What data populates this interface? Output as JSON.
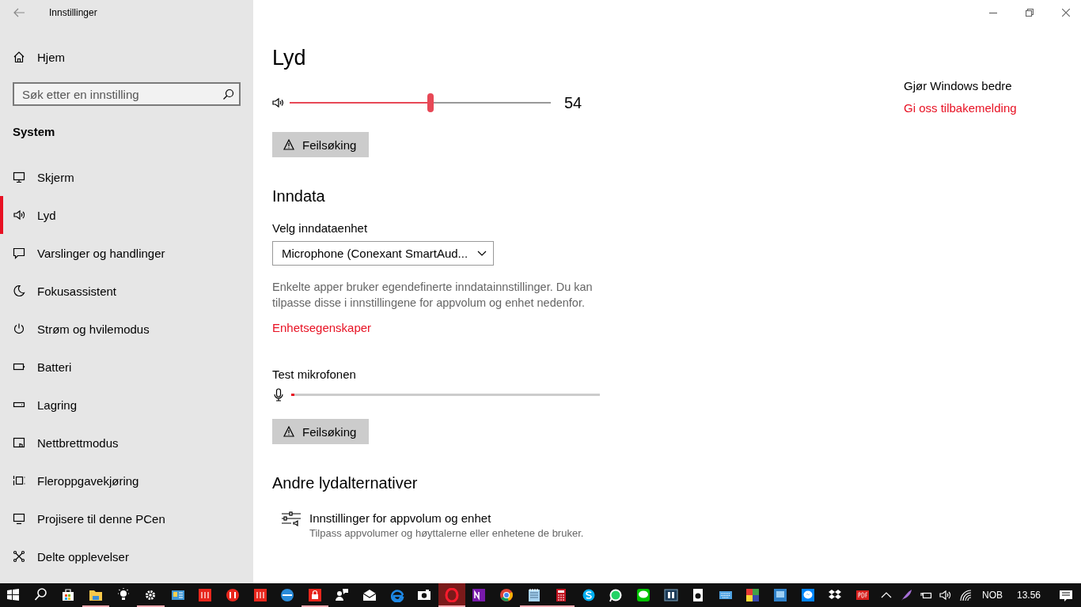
{
  "window": {
    "title": "Innstillinger"
  },
  "sidebar": {
    "home": "Hjem",
    "search": {
      "placeholder": "Søk etter en innstilling"
    },
    "section": "System",
    "items": [
      {
        "label": "Skjerm",
        "kind": "display",
        "selected": false
      },
      {
        "label": "Lyd",
        "kind": "sound",
        "selected": true
      },
      {
        "label": "Varslinger og handlinger",
        "kind": "message",
        "selected": false
      },
      {
        "label": "Fokusassistent",
        "kind": "moon",
        "selected": false
      },
      {
        "label": "Strøm og hvilemodus",
        "kind": "power",
        "selected": false
      },
      {
        "label": "Batteri",
        "kind": "battery",
        "selected": false
      },
      {
        "label": "Lagring",
        "kind": "storage",
        "selected": false
      },
      {
        "label": "Nettbrettmodus",
        "kind": "tablet",
        "selected": false
      },
      {
        "label": "Fleroppgavekjøring",
        "kind": "multitask",
        "selected": false
      },
      {
        "label": "Projisere til denne PCen",
        "kind": "project",
        "selected": false
      },
      {
        "label": "Delte opplevelser",
        "kind": "share",
        "selected": false
      }
    ]
  },
  "main": {
    "title": "Lyd",
    "volume": {
      "level": 0.54,
      "reading": "54"
    },
    "troubleshoot_output": "Feilsøking",
    "input_heading": "Inndata",
    "device_label": "Velg inndataenhet",
    "device_value": "Microphone (Conexant SmartAud...",
    "description": "Enkelte apper bruker egendefinerte inndatainnstillinger. Du kan tilpasse disse i innstillingene for appvolum og enhet nedenfor.",
    "device_link": "Enhetsegenskaper",
    "test_label": "Test mikrofonen",
    "mic": {
      "level": 0.01
    },
    "troubleshoot_input": "Feilsøking",
    "other_heading": "Andre lydalternativer",
    "option": {
      "title": "Innstillinger for appvolum og enhet",
      "subtitle": "Tilpass appvolumer og høyttalerne eller enhetene de bruker."
    }
  },
  "aside": {
    "heading": "Gjør Windows bedre",
    "link": "Gi oss tilbakemelding"
  },
  "taskbar": {
    "apps": [
      {
        "kind": "start",
        "running": false,
        "active": false
      },
      {
        "kind": "search",
        "running": false,
        "active": false
      },
      {
        "kind": "store",
        "running": false,
        "active": false
      },
      {
        "kind": "folder",
        "running": true,
        "active": false
      },
      {
        "kind": "bulb",
        "running": false,
        "active": false
      },
      {
        "kind": "gear",
        "running": true,
        "active": false
      },
      {
        "kind": "card",
        "running": false,
        "active": false
      },
      {
        "kind": "red",
        "running": false,
        "active": false
      },
      {
        "kind": "redcircle",
        "running": false,
        "active": false
      },
      {
        "kind": "red",
        "running": false,
        "active": false
      },
      {
        "kind": "bluecircle",
        "running": false,
        "active": false
      },
      {
        "kind": "lock",
        "running": true,
        "active": false
      },
      {
        "kind": "people",
        "running": false,
        "active": false
      },
      {
        "kind": "mail",
        "running": false,
        "active": false
      },
      {
        "kind": "edge",
        "running": false,
        "active": false
      },
      {
        "kind": "camera",
        "running": false,
        "active": false
      },
      {
        "kind": "opera",
        "running": true,
        "active": true
      },
      {
        "kind": "onenote",
        "running": false,
        "active": false
      },
      {
        "kind": "chrome",
        "running": false,
        "active": false
      },
      {
        "kind": "notepad",
        "running": true,
        "active": false
      },
      {
        "kind": "calculator",
        "running": true,
        "active": false
      },
      {
        "kind": "skype",
        "running": false,
        "active": false
      },
      {
        "kind": "whatsapp",
        "running": false,
        "active": false
      },
      {
        "kind": "chat",
        "running": false,
        "active": false
      },
      {
        "kind": "dolby",
        "running": false,
        "active": false
      },
      {
        "kind": "webcam",
        "running": false,
        "active": false
      },
      {
        "kind": "keyboard",
        "running": false,
        "active": false
      },
      {
        "kind": "colors",
        "running": false,
        "active": false
      },
      {
        "kind": "bluewin",
        "running": false,
        "active": false
      },
      {
        "kind": "messenger",
        "running": false,
        "active": false
      },
      {
        "kind": "dropbox",
        "running": false,
        "active": false
      },
      {
        "kind": "pdf",
        "running": false,
        "active": false
      }
    ],
    "language": "NOB",
    "time": "13.56"
  }
}
